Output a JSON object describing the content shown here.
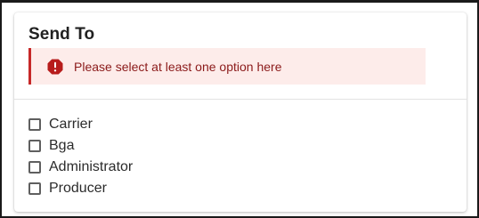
{
  "card": {
    "title": "Send To"
  },
  "alert": {
    "icon": "error-octagon-icon",
    "message": "Please select at least one option here",
    "color_background": "#fdecea",
    "color_accent": "#c62828",
    "color_text": "#8b1a1a"
  },
  "options": [
    {
      "label": "Carrier",
      "checked": false
    },
    {
      "label": "Bga",
      "checked": false
    },
    {
      "label": "Administrator",
      "checked": false
    },
    {
      "label": "Producer",
      "checked": false
    }
  ]
}
